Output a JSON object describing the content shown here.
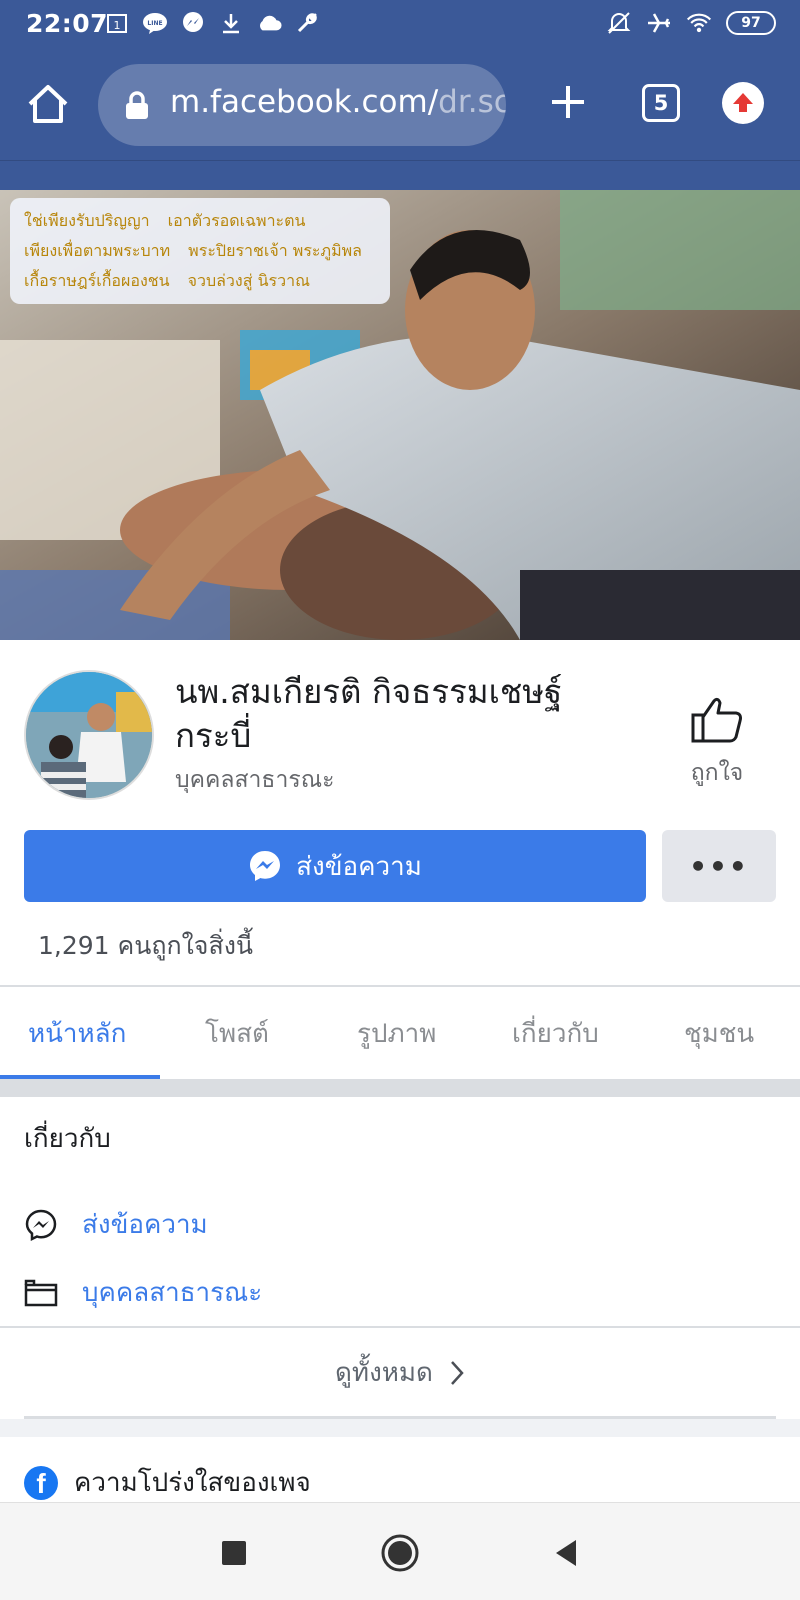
{
  "status_bar": {
    "time": "22:07",
    "battery": "97",
    "icons_left": [
      "calendar-icon",
      "line-app-icon",
      "messenger-icon",
      "download-icon",
      "cloud-icon",
      "wrench-icon"
    ],
    "icons_right": [
      "mute-icon",
      "airplane-mode-icon",
      "wifi-icon",
      "battery-icon"
    ]
  },
  "browser": {
    "url_main": "m.facebook.com/",
    "url_dim": "dr.sc",
    "tab_count": "5",
    "bar_color": "#3b5998"
  },
  "cover": {
    "poem_lines": [
      [
        "ใช่เพียงรับปริญญา",
        "เอาตัวรอดเฉพาะตน"
      ],
      [
        "เพียงเพื่อตามพระบาท",
        "พระปิยราชเจ้า พระภูมิพล"
      ],
      [
        "เกื้อราษฎร์เกื้อผองชน",
        "จวบล่วงสู่ นิรวาณ"
      ]
    ]
  },
  "profile": {
    "name": "นพ.สมเกียรติ กิจธรรมเชษฐ์ กระบี่",
    "category": "บุคคลสาธารณะ",
    "like_label": "ถูกใจ",
    "send_message_label": "ส่งข้อความ",
    "more_label": "•••",
    "likes_text": "1,291 คนถูกใจสิ่งนี้"
  },
  "tabs": [
    {
      "label": "หน้าหลัก",
      "active": true
    },
    {
      "label": "โพสต์",
      "active": false
    },
    {
      "label": "รูปภาพ",
      "active": false
    },
    {
      "label": "เกี่ยวกับ",
      "active": false
    },
    {
      "label": "ชุมชน",
      "active": false
    }
  ],
  "about": {
    "title": "เกี่ยวกับ",
    "message_link": "ส่งข้อความ",
    "category_link": "บุคคลสาธารณะ",
    "see_all": "ดูทั้งหมด",
    "transparency": "ความโปร่งใสของเพจ"
  },
  "colors": {
    "accent": "#3b7be8",
    "header": "#3b5998"
  }
}
